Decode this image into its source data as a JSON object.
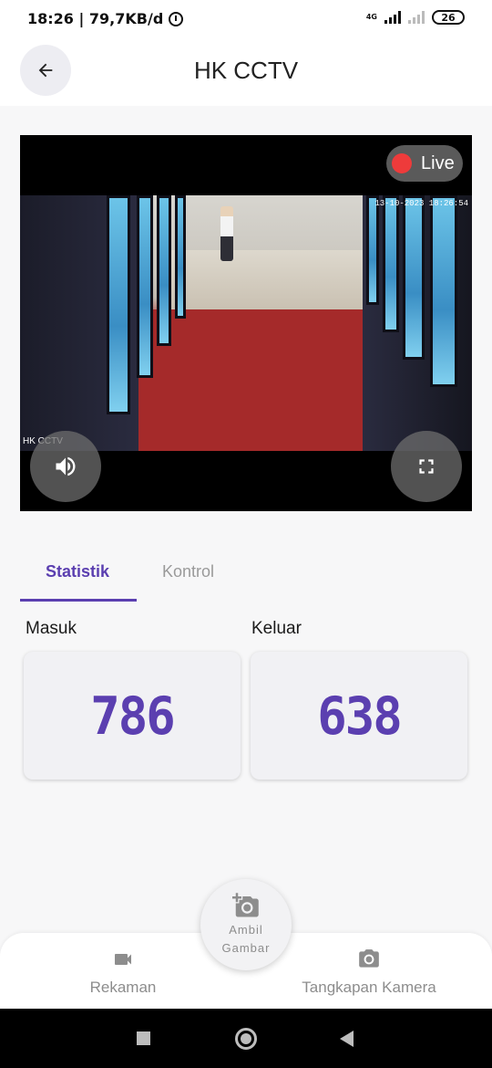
{
  "status_bar": {
    "time_speed": "18:26 | 79,7KB/d",
    "network": "4G",
    "battery": "26"
  },
  "header": {
    "title": "HK CCTV",
    "back_icon": "arrow-left-icon"
  },
  "video": {
    "live_label": "Live",
    "overlay_label": "HK CCTV",
    "timestamp": "13-10-2023 18:26:54",
    "volume_icon": "volume-icon",
    "fullscreen_icon": "fullscreen-icon"
  },
  "tabs": [
    {
      "label": "Statistik",
      "active": true
    },
    {
      "label": "Kontrol",
      "active": false
    }
  ],
  "stats": {
    "masuk": {
      "label": "Masuk",
      "value": "786"
    },
    "keluar": {
      "label": "Keluar",
      "value": "638"
    }
  },
  "bottom_nav": {
    "rekaman": {
      "label": "Rekaman",
      "icon": "videocam-icon"
    },
    "fab": {
      "label": "Ambil Gambar",
      "icon": "add-photo-icon"
    },
    "tangkapan": {
      "label": "Tangkapan Kamera",
      "icon": "camera-icon"
    }
  },
  "colors": {
    "accent": "#5b3fb0",
    "live_dot": "#ee3b3b"
  }
}
